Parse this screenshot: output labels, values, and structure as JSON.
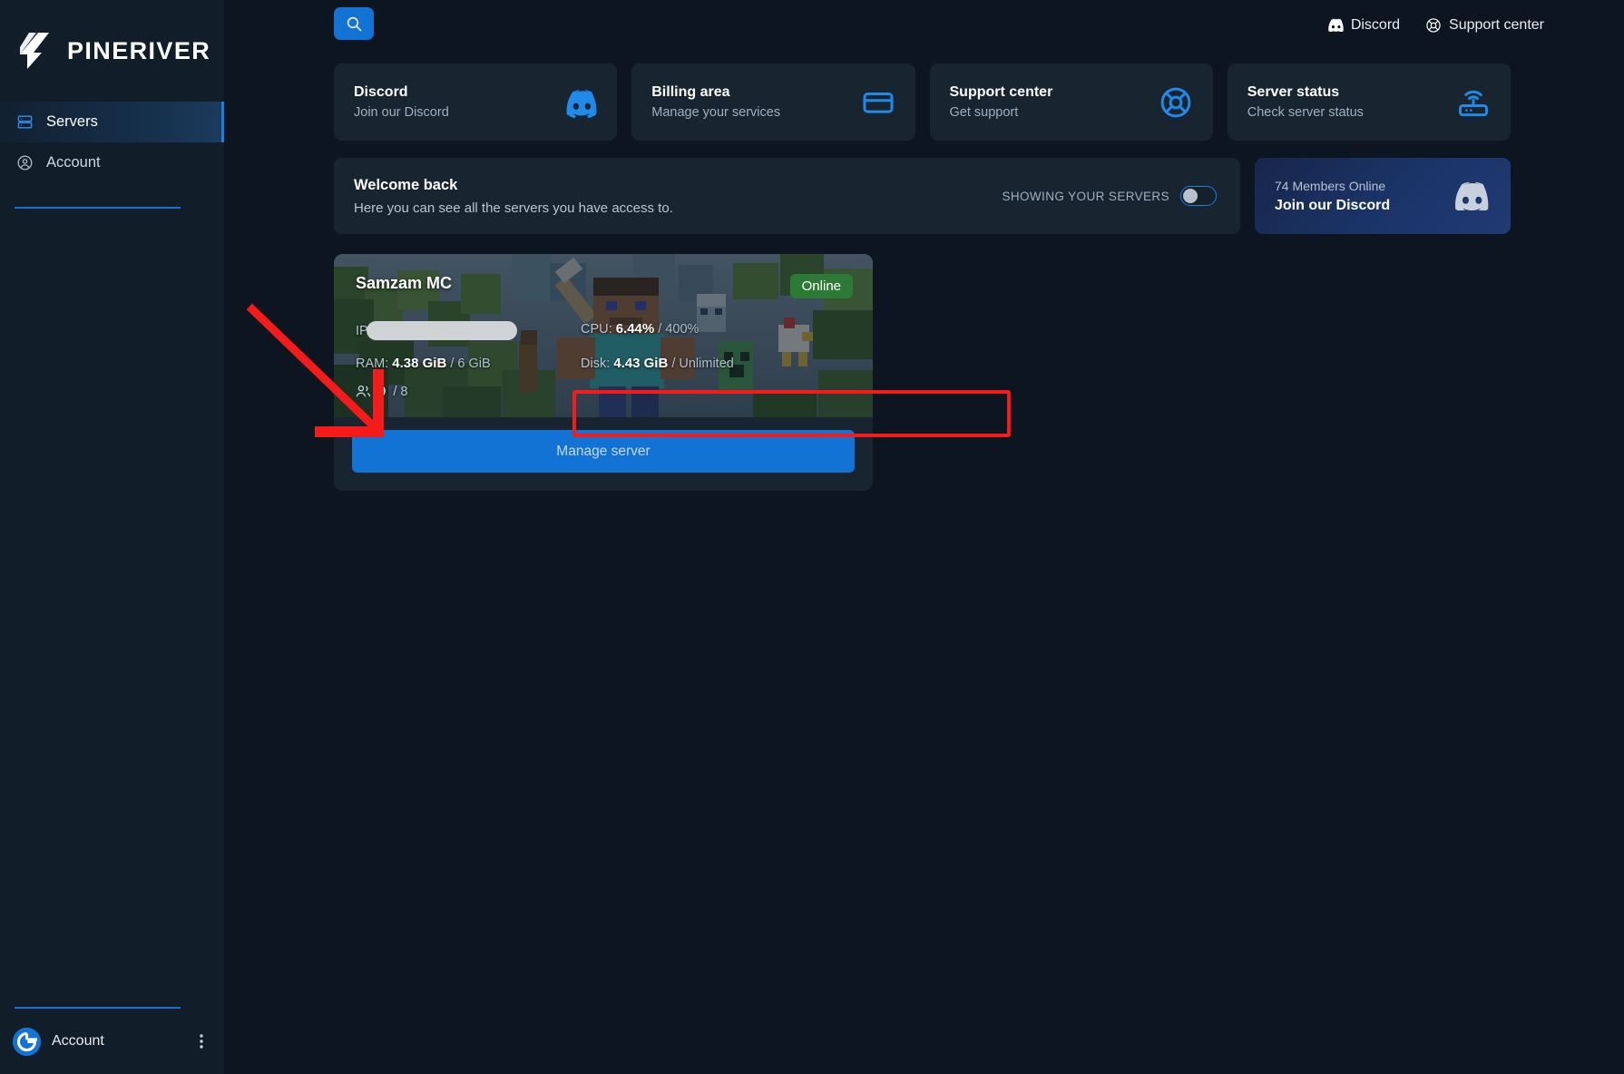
{
  "brand": {
    "name": "PINERIVER",
    "logo_icon": "pineriver-logo-icon"
  },
  "sidebar": {
    "items": [
      {
        "label": "Servers",
        "icon": "server-rack-icon",
        "active": true
      },
      {
        "label": "Account",
        "icon": "user-circle-icon",
        "active": false
      }
    ],
    "account": {
      "label": "Account",
      "avatar_icon": "gravatar-avatar-icon",
      "menu_icon": "kebab-menu-icon"
    }
  },
  "topbar": {
    "search_icon": "search-icon",
    "links": [
      {
        "label": "Discord",
        "icon": "discord-icon"
      },
      {
        "label": "Support center",
        "icon": "lifebuoy-icon"
      }
    ]
  },
  "quick_cards": [
    {
      "title": "Discord",
      "subtitle": "Join our Discord",
      "icon": "discord-icon"
    },
    {
      "title": "Billing area",
      "subtitle": "Manage your services",
      "icon": "credit-card-icon"
    },
    {
      "title": "Support center",
      "subtitle": "Get support",
      "icon": "lifebuoy-icon"
    },
    {
      "title": "Server status",
      "subtitle": "Check server status",
      "icon": "router-icon"
    }
  ],
  "welcome": {
    "title": "Welcome back",
    "subtitle": "Here you can see all the servers you have access to.",
    "toggle_label": "SHOWING YOUR SERVERS",
    "toggle_on": false
  },
  "discord_promo": {
    "members": "74 Members Online",
    "cta": "Join our Discord",
    "icon": "discord-icon"
  },
  "server": {
    "name": "Samzam MC",
    "status": "Online",
    "ip_label": "IP:",
    "ip_value": "",
    "ram_label": "RAM:",
    "ram_used": "4.38 GiB",
    "ram_total": "/ 6 GiB",
    "cpu_label": "CPU:",
    "cpu_used": "6.44%",
    "cpu_total": "/ 400%",
    "disk_label": "Disk:",
    "disk_used": "4.43 GiB",
    "disk_total": "/ Unlimited",
    "players_icon": "players-icon",
    "players_current": "0",
    "players_total": "/ 8",
    "manage_label": "Manage server"
  },
  "colors": {
    "accent_blue": "#1273d4",
    "sidebar_bg": "#111d29",
    "page_bg": "#0d1620",
    "card_bg": "#18242f",
    "status_green": "#2c7a36",
    "annotation_red": "#f51b1b"
  }
}
